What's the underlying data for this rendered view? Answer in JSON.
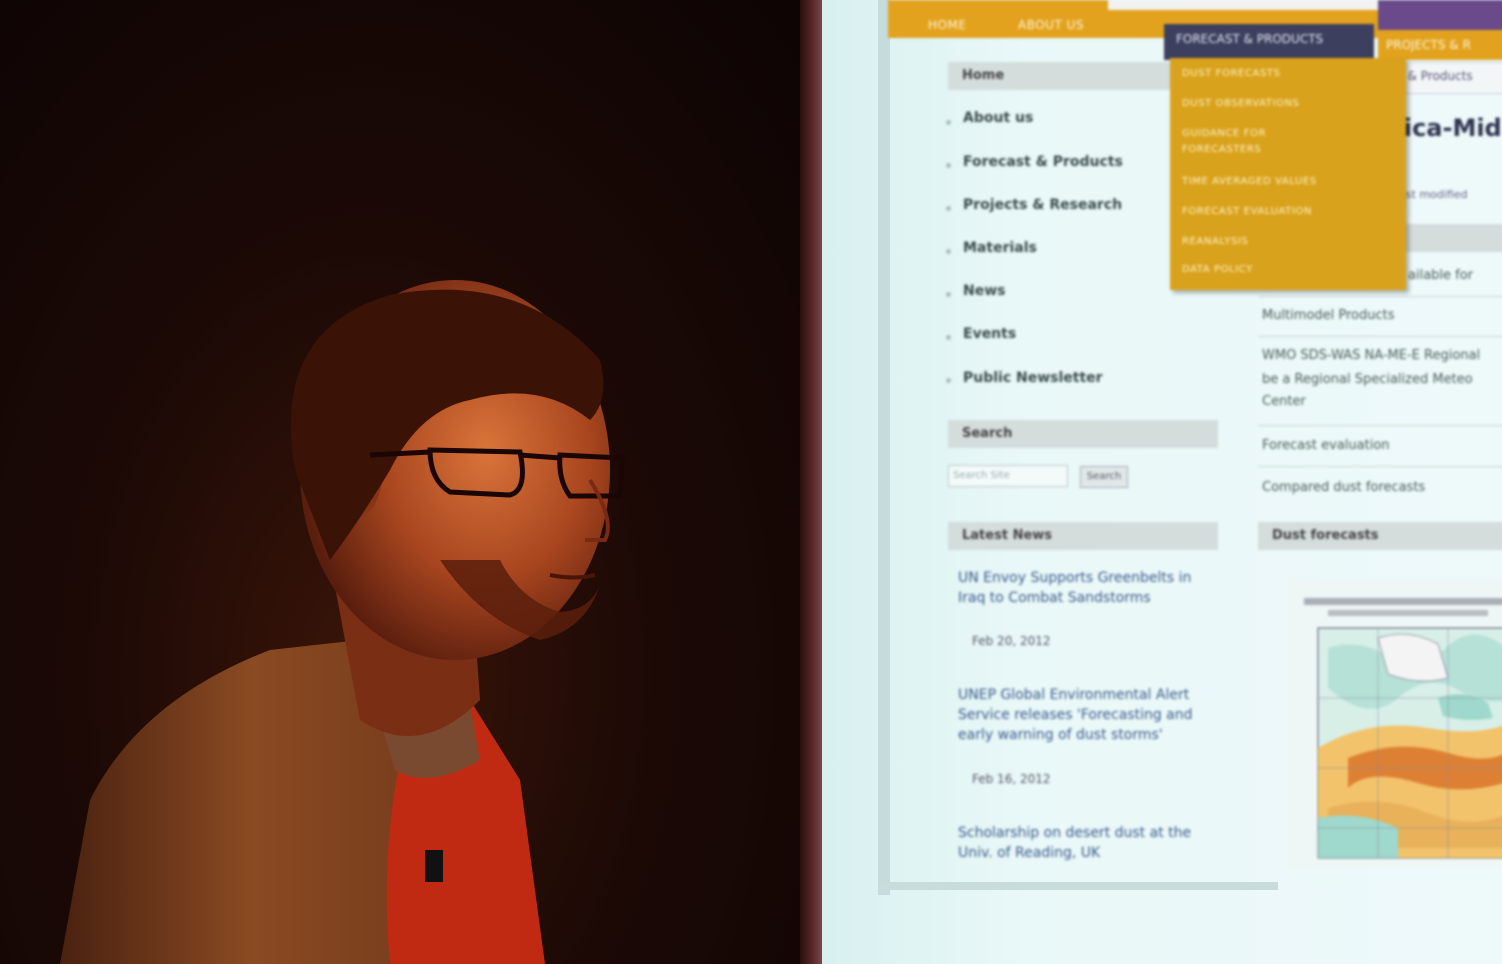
{
  "site": {
    "nav": [
      "HOME",
      "ABOUT US",
      "FORECAST & PRODUCTS",
      "PROJECTS & R"
    ],
    "dropdown": [
      "DUST FORECASTS",
      "DUST OBSERVATIONS",
      "GUIDANCE FOR",
      "FORECASTERS",
      "TIME AVERAGED VALUES",
      "FORECAST EVALUATION",
      "REANALYSIS",
      "DATA POLICY"
    ],
    "sidebar": {
      "home": "Home",
      "links": [
        "About us",
        "Forecast & Products",
        "Projects & Research",
        "Materials",
        "News",
        "Events",
        "Public Newsletter"
      ],
      "search_label": "Search",
      "search_placeholder": "Search Site",
      "search_button": "Search",
      "latest_news": "Latest News",
      "news": [
        {
          "title": "UN Envoy Supports Greenbelts in Iraq to Combat Sandstorms",
          "date": "Feb 20, 2012"
        },
        {
          "title": "UNEP Global Environmental Alert Service releases 'Forecasting and early warning of dust storms'",
          "date": "Feb 16, 2012"
        },
        {
          "title": "Scholarship on desert dust at the Univ. of Reading, UK",
          "date": ""
        }
      ]
    },
    "content": {
      "tab": "Forecast & Products",
      "heading": "rica-Mid",
      "modified": "last modified",
      "available": "ailable for",
      "multimodel": "Multimodel Products",
      "sds": "WMO SDS-WAS NA-ME-E Regional",
      "sds2": "be a Regional Specialized Meteo",
      "sds3": "Center",
      "evaluation": "Forecast evaluation",
      "compared": "Compared dust forecasts",
      "dust_forecasts": "Dust forecasts"
    }
  },
  "colors": {
    "accent_orange": "#e2a21e",
    "dropdown": "#d9a21c",
    "nav_active": "#3c3f5e",
    "screen": "#e9f8f8"
  }
}
